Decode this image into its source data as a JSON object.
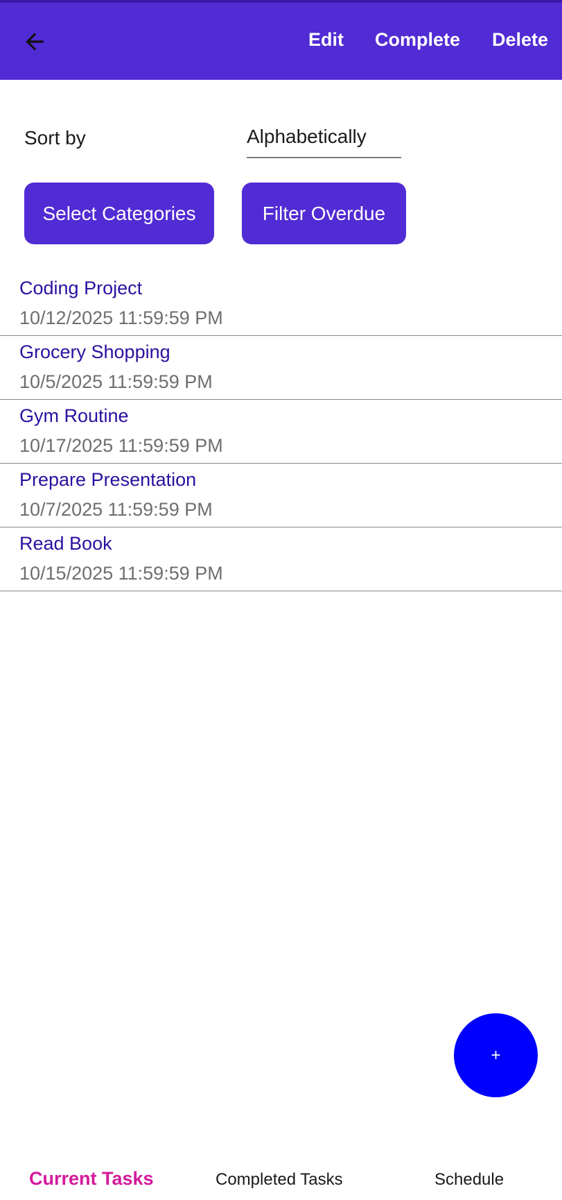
{
  "toolbar": {
    "back_icon": "arrow-left-icon",
    "actions": {
      "edit": "Edit",
      "complete": "Complete",
      "delete": "Delete"
    }
  },
  "sort": {
    "label": "Sort by",
    "selected": "Alphabetically"
  },
  "filters": {
    "select_categories": "Select Categories",
    "filter_overdue": "Filter Overdue"
  },
  "tasks": [
    {
      "title": "Coding Project",
      "due": "10/12/2025 11:59:59 PM"
    },
    {
      "title": "Grocery Shopping",
      "due": "10/5/2025 11:59:59 PM"
    },
    {
      "title": "Gym Routine",
      "due": "10/17/2025 11:59:59 PM"
    },
    {
      "title": "Prepare Presentation",
      "due": "10/7/2025 11:59:59 PM"
    },
    {
      "title": "Read Book",
      "due": "10/15/2025 11:59:59 PM"
    }
  ],
  "fab": {
    "label": "+"
  },
  "tabs": [
    {
      "label": "Current Tasks",
      "active": true
    },
    {
      "label": "Completed Tasks",
      "active": false
    },
    {
      "label": "Schedule",
      "active": false
    }
  ],
  "colors": {
    "primary": "#512bd4",
    "fab": "#0000ff",
    "task_title": "#2c0fa0",
    "task_date": "#6e6e6e",
    "active_tab": "#d4199b"
  }
}
